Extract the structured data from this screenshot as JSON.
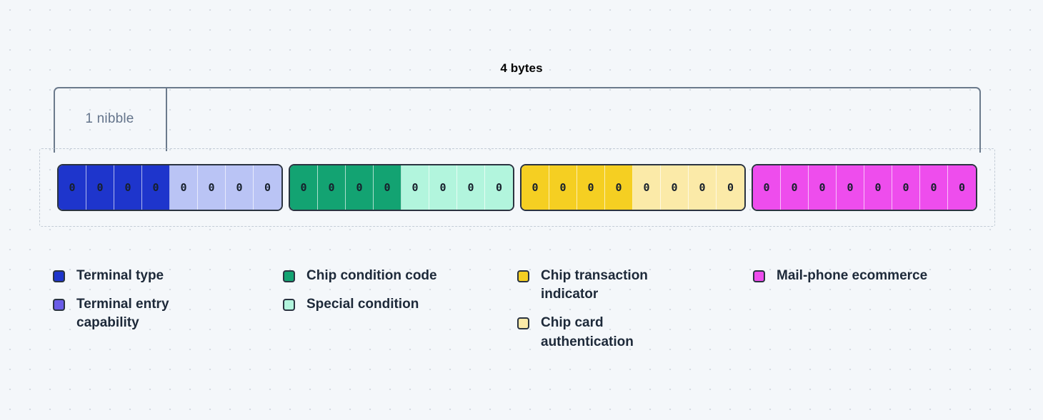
{
  "diagram": {
    "measure_label": "4 bytes",
    "nibble_label": "1 nibble",
    "bit_value": "0",
    "groups": [
      {
        "name": "byte-group-1",
        "cells": [
          {
            "value": "0",
            "color": "#1e35cc"
          },
          {
            "value": "0",
            "color": "#1e35cc"
          },
          {
            "value": "0",
            "color": "#1e35cc"
          },
          {
            "value": "0",
            "color": "#1e35cc"
          },
          {
            "value": "0",
            "color": "#bac4f5"
          },
          {
            "value": "0",
            "color": "#bac4f5"
          },
          {
            "value": "0",
            "color": "#bac4f5"
          },
          {
            "value": "0",
            "color": "#bac4f5"
          }
        ]
      },
      {
        "name": "byte-group-2",
        "cells": [
          {
            "value": "0",
            "color": "#13a372"
          },
          {
            "value": "0",
            "color": "#13a372"
          },
          {
            "value": "0",
            "color": "#13a372"
          },
          {
            "value": "0",
            "color": "#13a372"
          },
          {
            "value": "0",
            "color": "#b2f5dd"
          },
          {
            "value": "0",
            "color": "#b2f5dd"
          },
          {
            "value": "0",
            "color": "#b2f5dd"
          },
          {
            "value": "0",
            "color": "#b2f5dd"
          }
        ]
      },
      {
        "name": "byte-group-3",
        "cells": [
          {
            "value": "0",
            "color": "#f5cf22"
          },
          {
            "value": "0",
            "color": "#f5cf22"
          },
          {
            "value": "0",
            "color": "#f5cf22"
          },
          {
            "value": "0",
            "color": "#f5cf22"
          },
          {
            "value": "0",
            "color": "#fbeaa8"
          },
          {
            "value": "0",
            "color": "#fbeaa8"
          },
          {
            "value": "0",
            "color": "#fbeaa8"
          },
          {
            "value": "0",
            "color": "#fbeaa8"
          }
        ]
      },
      {
        "name": "byte-group-4",
        "cells": [
          {
            "value": "0",
            "color": "#ee4ded"
          },
          {
            "value": "0",
            "color": "#ee4ded"
          },
          {
            "value": "0",
            "color": "#ee4ded"
          },
          {
            "value": "0",
            "color": "#ee4ded"
          },
          {
            "value": "0",
            "color": "#ee4ded"
          },
          {
            "value": "0",
            "color": "#ee4ded"
          },
          {
            "value": "0",
            "color": "#ee4ded"
          },
          {
            "value": "0",
            "color": "#ee4ded"
          }
        ]
      }
    ]
  },
  "legend": {
    "columns": [
      {
        "items": [
          {
            "label": "Terminal type",
            "color": "#1e35cc"
          },
          {
            "label": "Terminal entry capability",
            "color": "#6a5ce8"
          }
        ]
      },
      {
        "items": [
          {
            "label": "Chip condition code",
            "color": "#13a372"
          },
          {
            "label": "Special condition",
            "color": "#b2f5dd"
          }
        ]
      },
      {
        "items": [
          {
            "label": "Chip transaction indicator",
            "color": "#f5cf22"
          },
          {
            "label": "Chip card authentication",
            "color": "#fbeaa8"
          }
        ]
      },
      {
        "items": [
          {
            "label": "Mail-phone ecommerce",
            "color": "#ee4ded"
          }
        ]
      }
    ]
  },
  "theme": {
    "background": "#f4f7fa",
    "dot_color": "#d5dbe3",
    "bracket_color": "#6b7a8c",
    "dashed_border": "#c3ccd6",
    "cell_border": "#2a3340",
    "text_primary": "#1d2939",
    "text_muted": "#64748b"
  }
}
